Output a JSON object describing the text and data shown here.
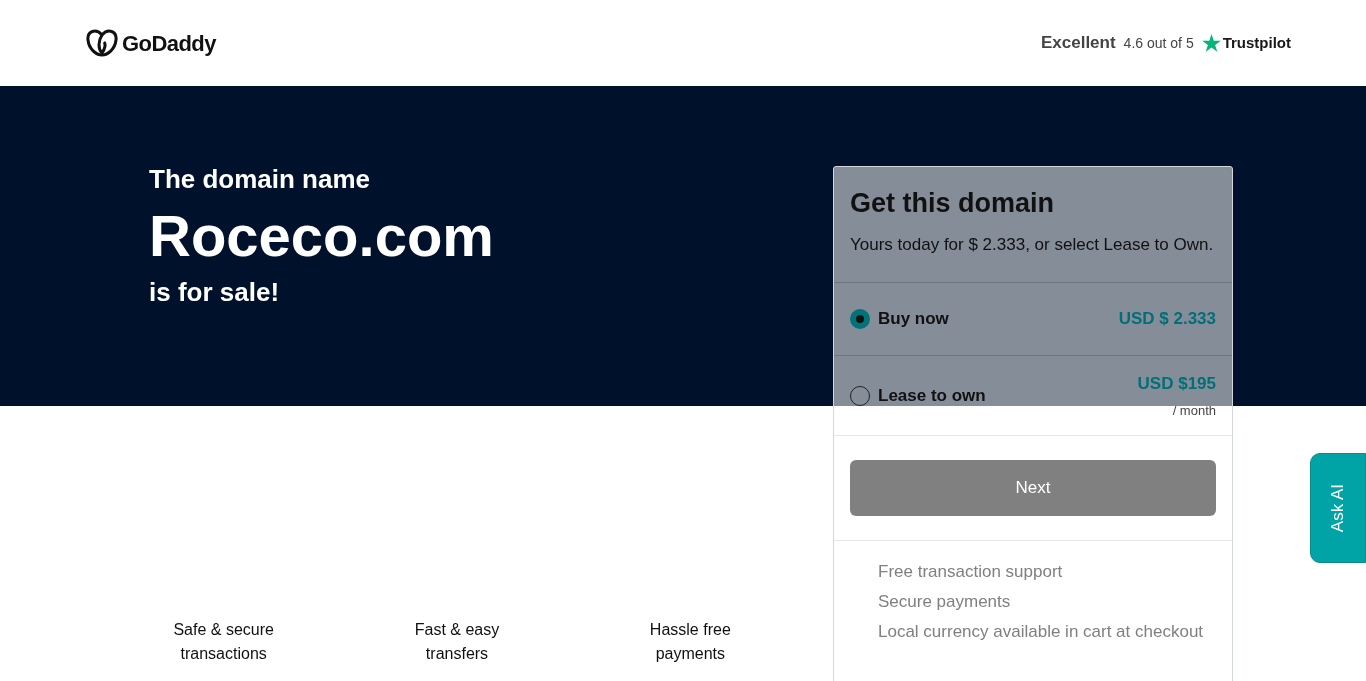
{
  "header": {
    "logo": "GoDaddy",
    "rating": {
      "label": "Excellent",
      "score": "4.6 out of 5",
      "brand": "Trustpilot"
    }
  },
  "hero": {
    "intro": "The domain name",
    "domain": "Roceco.com",
    "outro": "is for sale!"
  },
  "features": [
    {
      "label": "Safe & secure transactions"
    },
    {
      "label": "Fast & easy transfers"
    },
    {
      "label": "Hassle free payments"
    }
  ],
  "card": {
    "title": "Get this domain",
    "subtitle": "Yours today for $ 2.333, or select Lease to Own.",
    "options": [
      {
        "label": "Buy now",
        "price": "USD $ 2.333",
        "selected": true
      },
      {
        "label": "Lease to own",
        "price": "USD $195",
        "period": "/ month",
        "selected": false
      }
    ],
    "button": "Next",
    "benefits": [
      "Free transaction support",
      "Secure payments",
      "Local currency available in cart at checkout"
    ]
  },
  "ask_ai": "Ask AI"
}
